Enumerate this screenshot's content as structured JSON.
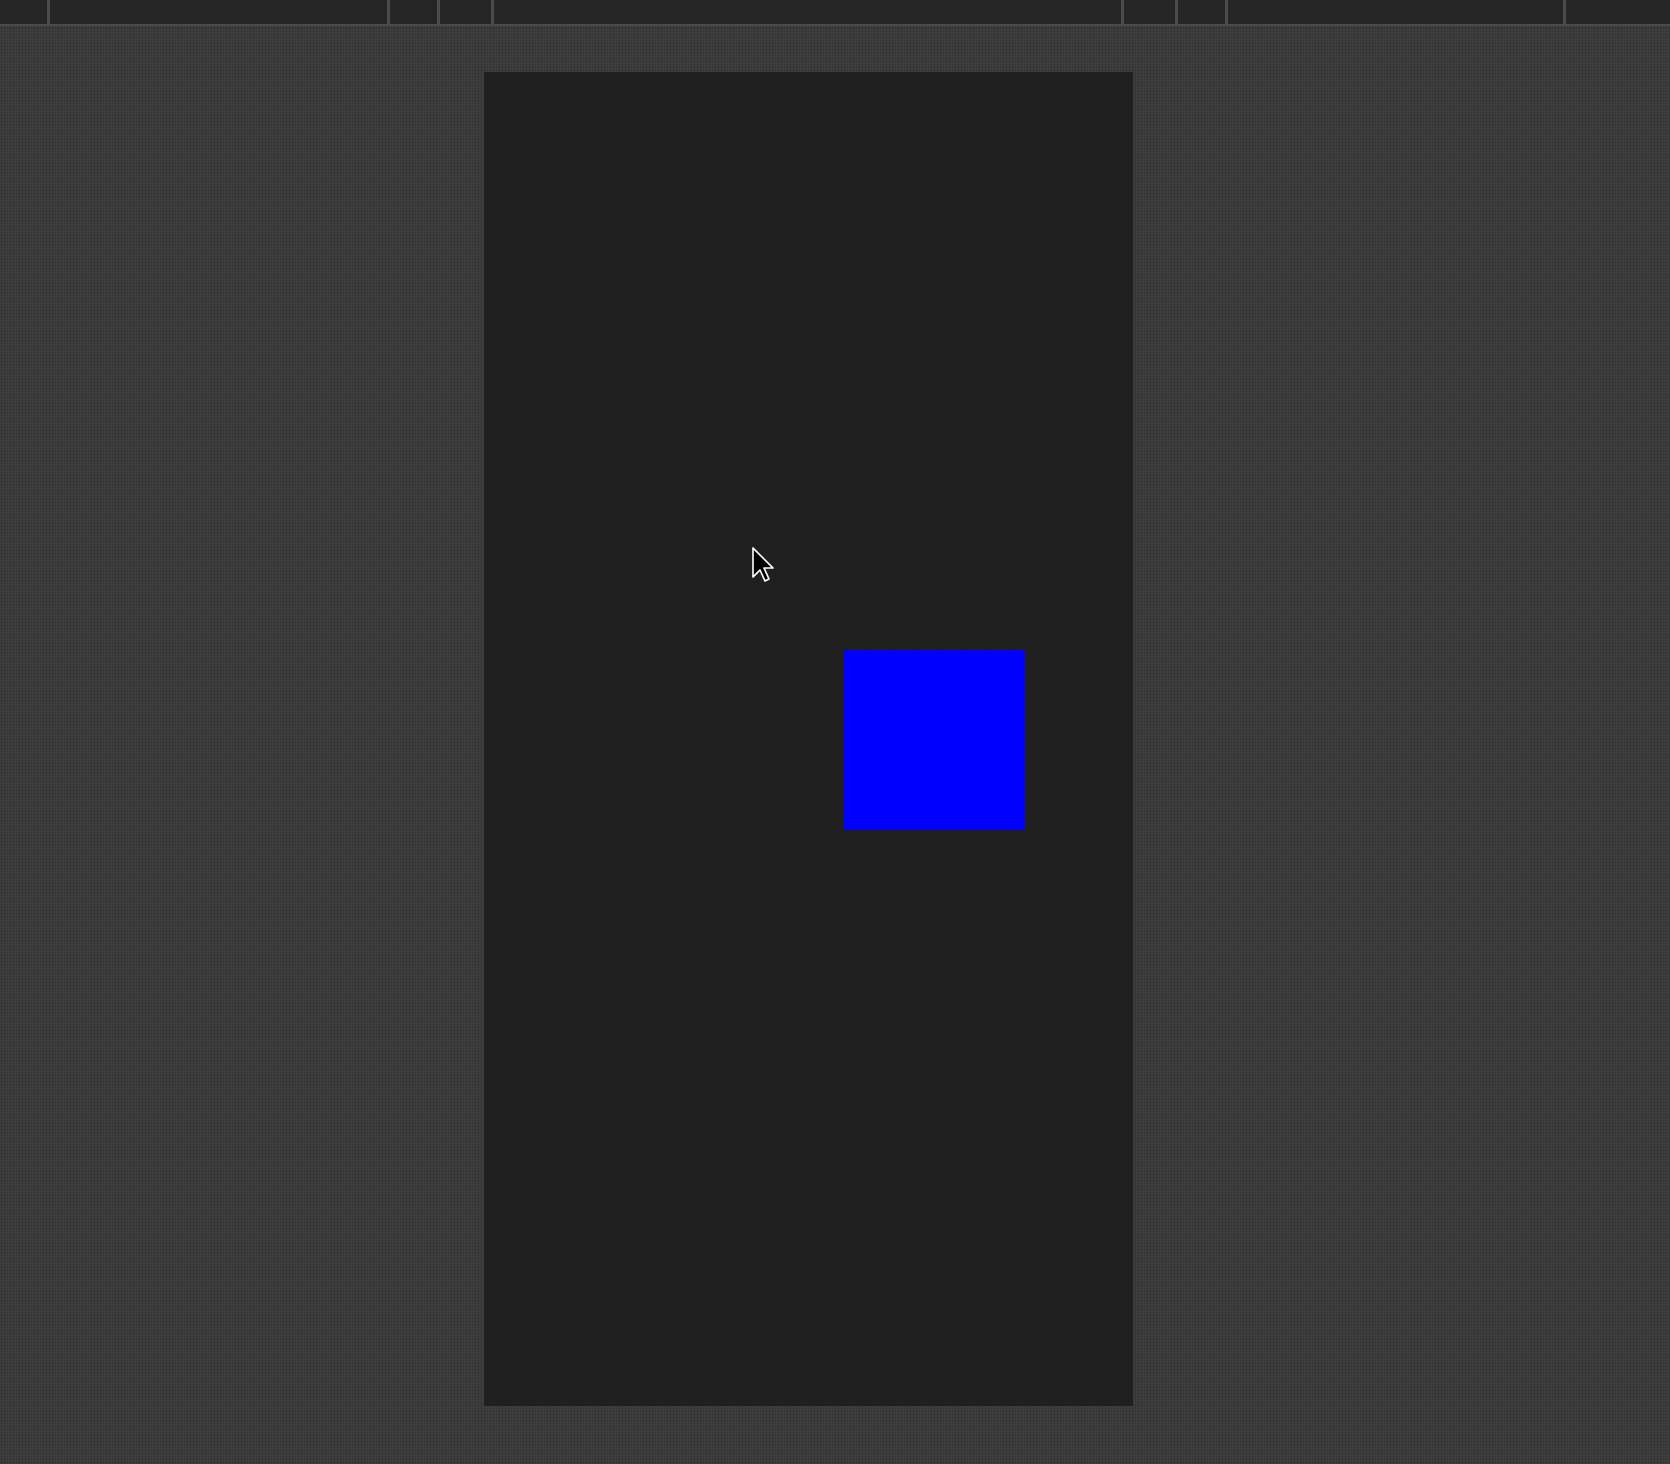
{
  "window": {
    "background_color": "#3a3a3a",
    "toolbar_color": "#262626"
  },
  "toolbar": {
    "segments": [
      "",
      "",
      "",
      "",
      "",
      "",
      "",
      "",
      "",
      ""
    ]
  },
  "canvas": {
    "background_color": "#1f1f1f",
    "shape": {
      "kind": "square",
      "color": "#0000ff"
    }
  },
  "cursor": {
    "icon": "arrow-pointer-icon",
    "fill": "#000000",
    "stroke": "#ffffff"
  }
}
